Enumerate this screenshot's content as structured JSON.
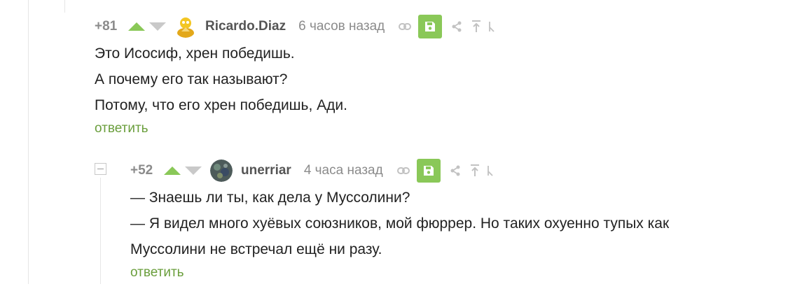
{
  "comments": [
    {
      "rating": "+81",
      "username": "Ricardo.Diaz",
      "time": "6 часов назад",
      "lines": [
        "Это Исосиф, хрен победишь.",
        "А почему его так называют?",
        "Потому, что его хрен победишь, Ади."
      ],
      "reply_label": "ответить"
    },
    {
      "rating": "+52",
      "username": "unerriar",
      "time": "4 часа назад",
      "lines": [
        "— Знаешь ли ты, как дела у Муссолини?",
        "— Я видел много хуёвых союзников, мой фюррер. Но таких охуенно тупых как",
        "Муссолини не встречал ещё ни разу."
      ],
      "reply_label": "ответить"
    }
  ],
  "colors": {
    "accent_green": "#8ac858",
    "reply_green": "#6a9e3c",
    "muted_gray": "#8b8b8b"
  },
  "icons": [
    "link-icon",
    "save-icon",
    "share-icon",
    "arrow-up-icon",
    "hide-icon"
  ]
}
